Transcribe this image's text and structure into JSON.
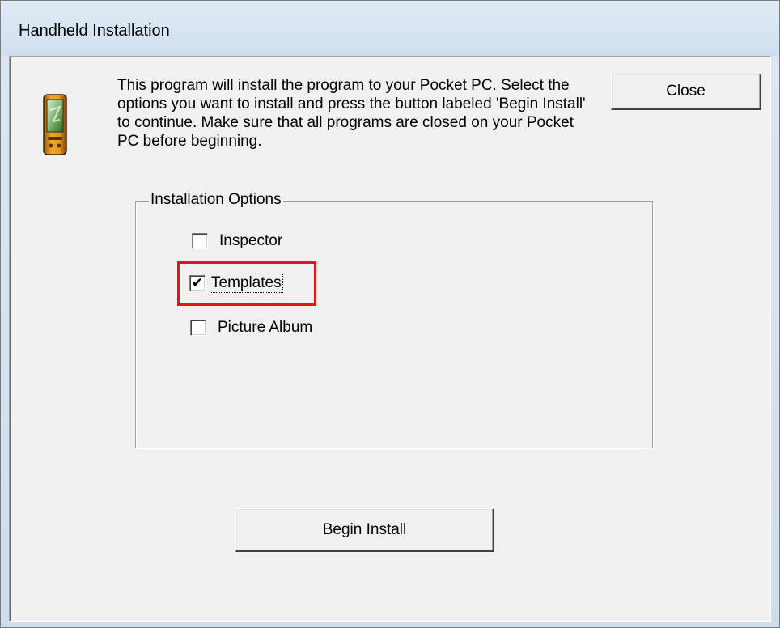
{
  "window": {
    "title": "Handheld Installation"
  },
  "icons": {
    "app_icon": "pocket-pc-icon",
    "check_glyph": "checkmark-icon"
  },
  "intro": {
    "text": "This program will install the program to your Pocket PC. Select the options you want to install and press the button labeled 'Begin Install' to continue. Make sure that all programs are closed on your Pocket PC before beginning."
  },
  "buttons": {
    "close_label": "Close",
    "begin_install_label": "Begin Install"
  },
  "options": {
    "group_label": "Installation Options",
    "items": [
      {
        "label": "Inspector",
        "checked": false
      },
      {
        "label": "Templates",
        "checked": true,
        "focused": true
      },
      {
        "label": "Picture Album",
        "checked": false
      }
    ]
  },
  "annotation": {
    "highlight_color": "#e3141c",
    "highlight_target": "Templates"
  }
}
